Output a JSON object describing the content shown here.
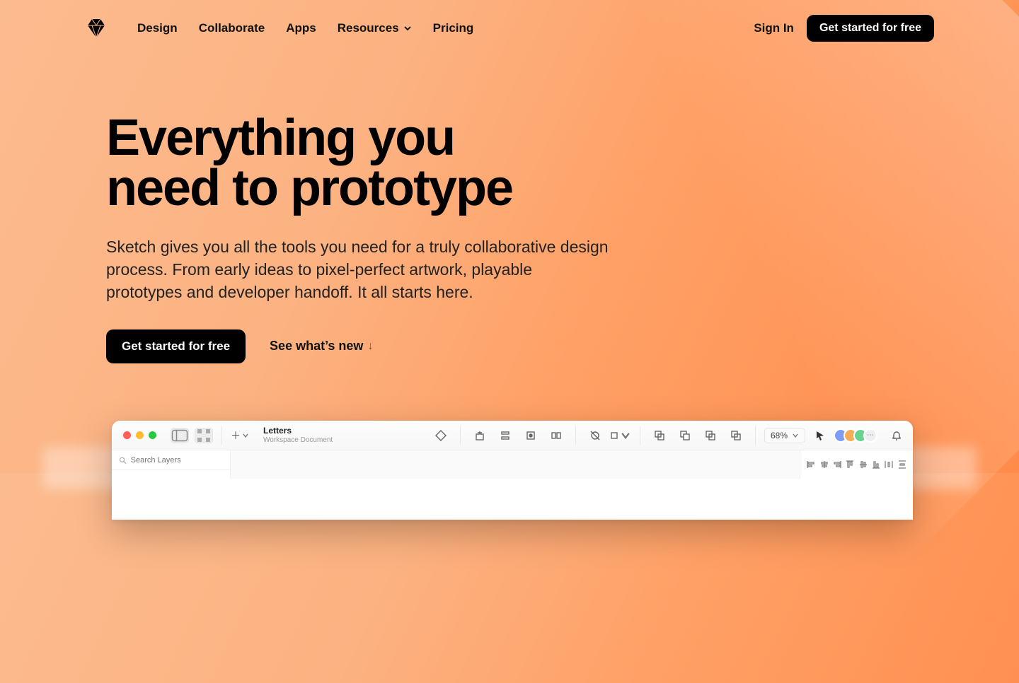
{
  "nav": {
    "links": [
      "Design",
      "Collaborate",
      "Apps",
      "Resources",
      "Pricing"
    ],
    "signin": "Sign In",
    "cta": "Get started for free"
  },
  "hero": {
    "title_line1": "Everything you",
    "title_line2": "need to prototype",
    "subtitle": "Sketch gives you all the tools you need for a truly collaborative design process. From early ideas to pixel-perfect artwork, playable prototypes and developer handoff. It all starts here.",
    "cta": "Get started for free",
    "whatsnew": "See what’s new"
  },
  "app": {
    "doc_title": "Letters",
    "doc_subtitle": "Workspace Document",
    "zoom": "68%",
    "search_placeholder": "Search Layers"
  }
}
